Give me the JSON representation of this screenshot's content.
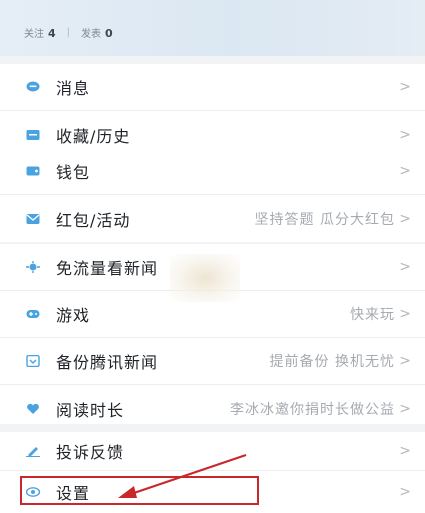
{
  "profile": {
    "following_label": "关注",
    "following_count": "4",
    "separator": "|",
    "posts_label": "发表",
    "posts_count": "0"
  },
  "menu": [
    {
      "label": "消息",
      "hint": "",
      "icon": "chat-bubble-icon"
    },
    {
      "label": "收藏/历史",
      "hint": "",
      "icon": "folder-icon"
    },
    {
      "label": "钱包",
      "hint": "",
      "icon": "wallet-icon"
    },
    {
      "label": "红包/活动",
      "hint": "坚持答题 瓜分大红包",
      "icon": "envelope-icon"
    },
    {
      "label": "免流量看新闻",
      "hint": "",
      "icon": "data-saver-icon"
    },
    {
      "label": "游戏",
      "hint": "快来玩",
      "icon": "gamepad-icon"
    },
    {
      "label": "备份腾讯新闻",
      "hint": "提前备份 换机无忧",
      "icon": "backup-icon"
    },
    {
      "label": "阅读时长",
      "hint": "李冰冰邀你捐时长做公益",
      "icon": "heart-hands-icon"
    },
    {
      "label": "投诉反馈",
      "hint": "",
      "icon": "pencil-icon"
    },
    {
      "label": "设置",
      "hint": "",
      "icon": "eye-icon"
    }
  ],
  "chevron": ">",
  "colors": {
    "icon_blue": "#4aa3e0",
    "annotation_red": "#c8282a",
    "header_bg": "#dbe7f2"
  }
}
